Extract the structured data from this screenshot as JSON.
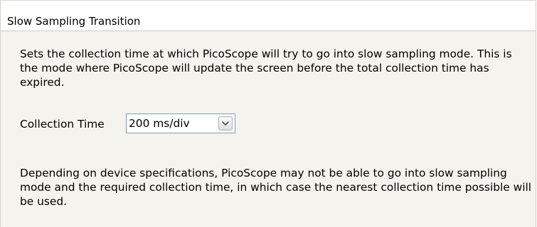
{
  "panel": {
    "title": "Slow Sampling Transition",
    "description": "Sets the collection time at which PicoScope will try to go into slow sampling mode. This is the mode where PicoScope will update the screen before the total collection time has expired.",
    "collection_time": {
      "label": "Collection Time",
      "value": "200 ms/div",
      "dropdown_icon": "chevron-down-icon"
    },
    "note": "Depending on device specifications, PicoScope may not be able to go into slow sampling mode and the required collection time, in which case the nearest collection time possible will be used."
  },
  "colors": {
    "panel_background": "#f4f3ee",
    "header_background": "#ffffff",
    "select_border": "#7f9db9",
    "text": "#000000"
  }
}
